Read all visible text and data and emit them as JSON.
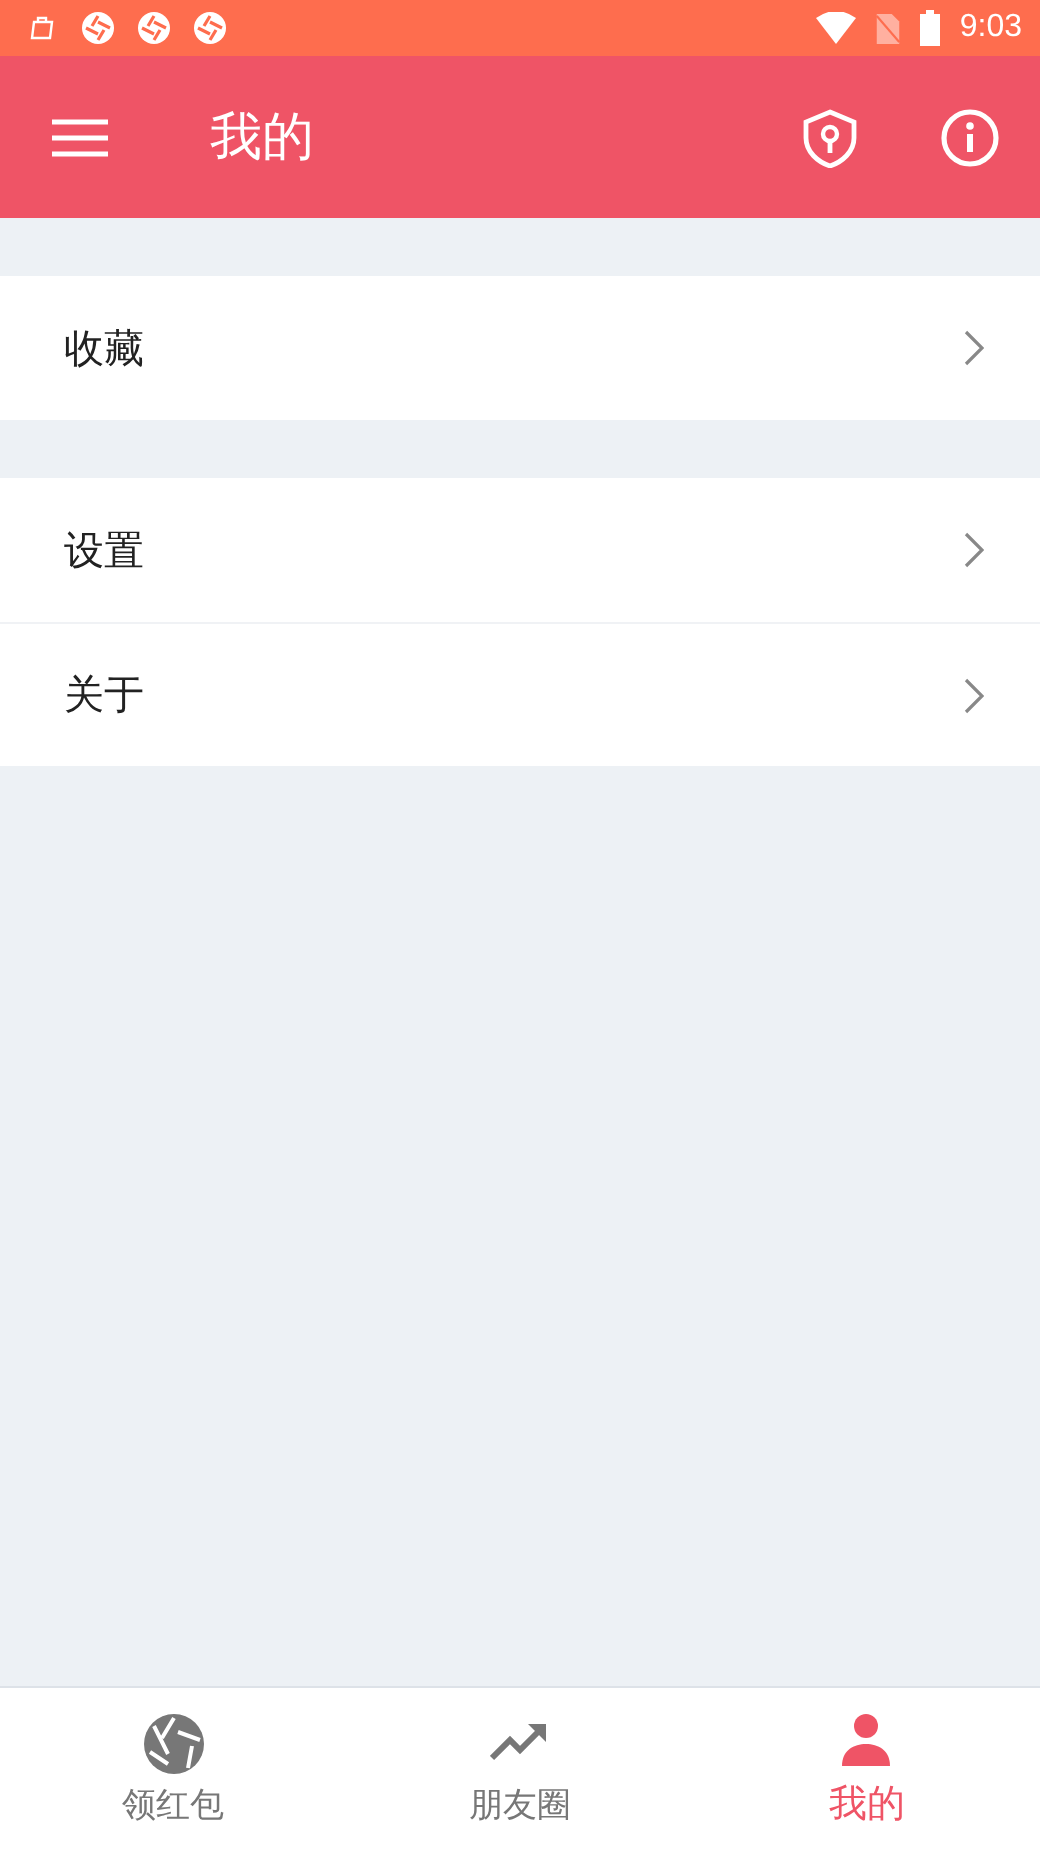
{
  "status_bar": {
    "time": "9:03",
    "notification_icons": [
      {
        "kind": "bag"
      },
      {
        "kind": "aperture"
      },
      {
        "kind": "aperture"
      },
      {
        "kind": "aperture"
      }
    ]
  },
  "app_bar": {
    "title": "我的"
  },
  "menu_groups": [
    {
      "items": [
        {
          "label": "收藏"
        }
      ]
    },
    {
      "items": [
        {
          "label": "设置"
        },
        {
          "label": "关于"
        }
      ]
    }
  ],
  "bottom_nav": [
    {
      "label": "领红包",
      "kind": "aperture",
      "selected": false
    },
    {
      "label": "朋友圈",
      "kind": "trend",
      "selected": false
    },
    {
      "label": "我的",
      "kind": "person",
      "selected": true
    }
  ]
}
